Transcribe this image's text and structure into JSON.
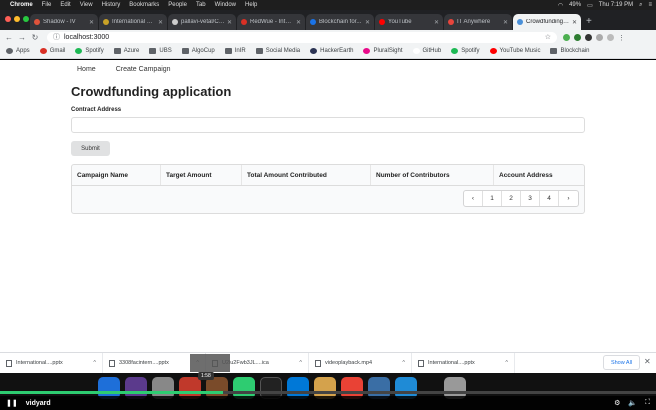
{
  "menubar": {
    "app": "Chrome",
    "items": [
      "File",
      "Edit",
      "View",
      "History",
      "Bookmarks",
      "People",
      "Tab",
      "Window",
      "Help"
    ],
    "battery": "49%",
    "clock": "Thu 7:19 PM"
  },
  "tabs": [
    {
      "title": "Shadow - IV",
      "color": "#e0533b",
      "active": false
    },
    {
      "title": "International W...",
      "color": "#c9a227",
      "active": false
    },
    {
      "title": "pallavi-vetal/Cro...",
      "color": "#ccc",
      "active": false
    },
    {
      "title": "RedWue - Inter...",
      "color": "#d93025",
      "active": false
    },
    {
      "title": "Blockchain for...",
      "color": "#1a73e8",
      "active": false
    },
    {
      "title": "YouTube",
      "color": "#ff0000",
      "active": false
    },
    {
      "title": "IT Anywhere",
      "color": "#e8453c",
      "active": false
    },
    {
      "title": "Crowdfunding a...",
      "color": "#4a90d9",
      "active": true
    }
  ],
  "omnibox": {
    "url": "localhost:3000"
  },
  "bookmarks": [
    {
      "label": "Apps",
      "icon": "apps-icon",
      "color": "#5f6368"
    },
    {
      "label": "Gmail",
      "icon": "gmail-icon",
      "color": "#d93025"
    },
    {
      "label": "Spotify",
      "icon": "spotify-icon",
      "color": "#1db954"
    },
    {
      "label": "Azure",
      "icon": "folder-icon",
      "color": "#5f6368"
    },
    {
      "label": "UBS",
      "icon": "folder-icon",
      "color": "#5f6368"
    },
    {
      "label": "AlgoCup",
      "icon": "folder-icon",
      "color": "#5f6368"
    },
    {
      "label": "InIR",
      "icon": "folder-icon",
      "color": "#5f6368"
    },
    {
      "label": "Social Media",
      "icon": "folder-icon",
      "color": "#5f6368"
    },
    {
      "label": "HackerEarth",
      "icon": "hackerearth-icon",
      "color": "#2c3454"
    },
    {
      "label": "PluralSight",
      "icon": "pluralsight-icon",
      "color": "#e80a89"
    },
    {
      "label": "GitHub",
      "icon": "github-icon",
      "color": "#fff"
    },
    {
      "label": "Spotify",
      "icon": "spotify-icon",
      "color": "#1db954"
    },
    {
      "label": "YouTube Music",
      "icon": "youtube-music-icon",
      "color": "#ff0000"
    },
    {
      "label": "Blockchain",
      "icon": "folder-icon",
      "color": "#5f6368"
    }
  ],
  "page": {
    "nav": [
      "Home",
      "Create Campaign"
    ],
    "title": "Crowdfunding application",
    "address_label": "Contract Address",
    "address_value": "",
    "submit": "Submit",
    "columns": [
      "Campaign Name",
      "Target Amount",
      "Total Amount Contributed",
      "Number of Contributors",
      "Account Address"
    ],
    "pagination": [
      "‹",
      "1",
      "2",
      "3",
      "4",
      "›"
    ]
  },
  "downloads": [
    {
      "name": "International....pptx"
    },
    {
      "name": "3308facintern....pptx"
    },
    {
      "name": "U2lu2Fwb3JL....ica"
    },
    {
      "name": "videoplayback.mp4"
    },
    {
      "name": "International....pptx"
    }
  ],
  "downloads_show_all": "Show All",
  "dock_tooltip": "1:58",
  "video": {
    "brand": "vidyard",
    "progress_fraction": 0.34
  },
  "colors": {
    "accent": "#2ecc71",
    "chrome_dark": "#202124"
  }
}
